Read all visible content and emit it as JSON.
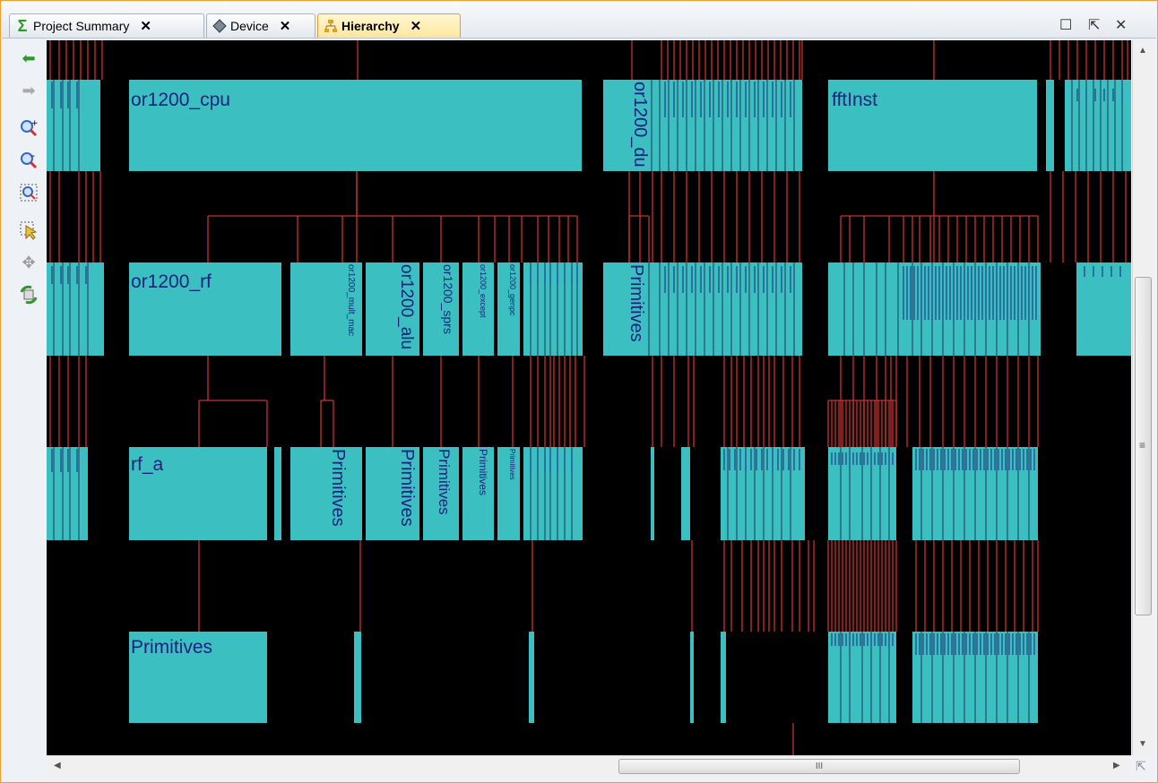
{
  "tabs": [
    {
      "label": "Project Summary",
      "icon": "sigma-icon",
      "active": false
    },
    {
      "label": "Device",
      "icon": "device-chip-icon",
      "active": false
    },
    {
      "label": "Hierarchy",
      "icon": "hierarchy-icon",
      "active": true
    }
  ],
  "tab_close_glyph": "✕",
  "window_buttons": {
    "maximize": "☐",
    "float": "⇱",
    "close": "✕"
  },
  "toolbar": [
    {
      "name": "back-icon",
      "glyph": "⬅"
    },
    {
      "name": "forward-icon",
      "glyph": "➡"
    },
    {
      "name": "zoom-in-icon",
      "glyph": "🔍"
    },
    {
      "name": "zoom-out-icon",
      "glyph": "🔍"
    },
    {
      "name": "zoom-fit-icon",
      "glyph": "⊡"
    },
    {
      "name": "select-icon",
      "glyph": "↖"
    },
    {
      "name": "move-icon",
      "glyph": "✥"
    },
    {
      "name": "refresh-icon",
      "glyph": "⟳"
    }
  ],
  "hierarchy": {
    "labels": {
      "cpu": "or1200_cpu",
      "du": "or1200_du",
      "fft": "fftInst",
      "rf": "or1200_rf",
      "mult_mac": "or1200_mult_mac",
      "alu": "or1200_alu",
      "sprs": "or1200_sprs",
      "except": "or1200_except",
      "genpc": "or1200_genpc",
      "primitives": "Primitives",
      "rf_a": "rf_a"
    },
    "colors": {
      "block": "#3cbfc0",
      "wire": "#c83232",
      "background": "#000000",
      "text": "#1a237e"
    }
  },
  "scrollbars": {
    "h_grip": "III",
    "v_grip": "≡"
  }
}
